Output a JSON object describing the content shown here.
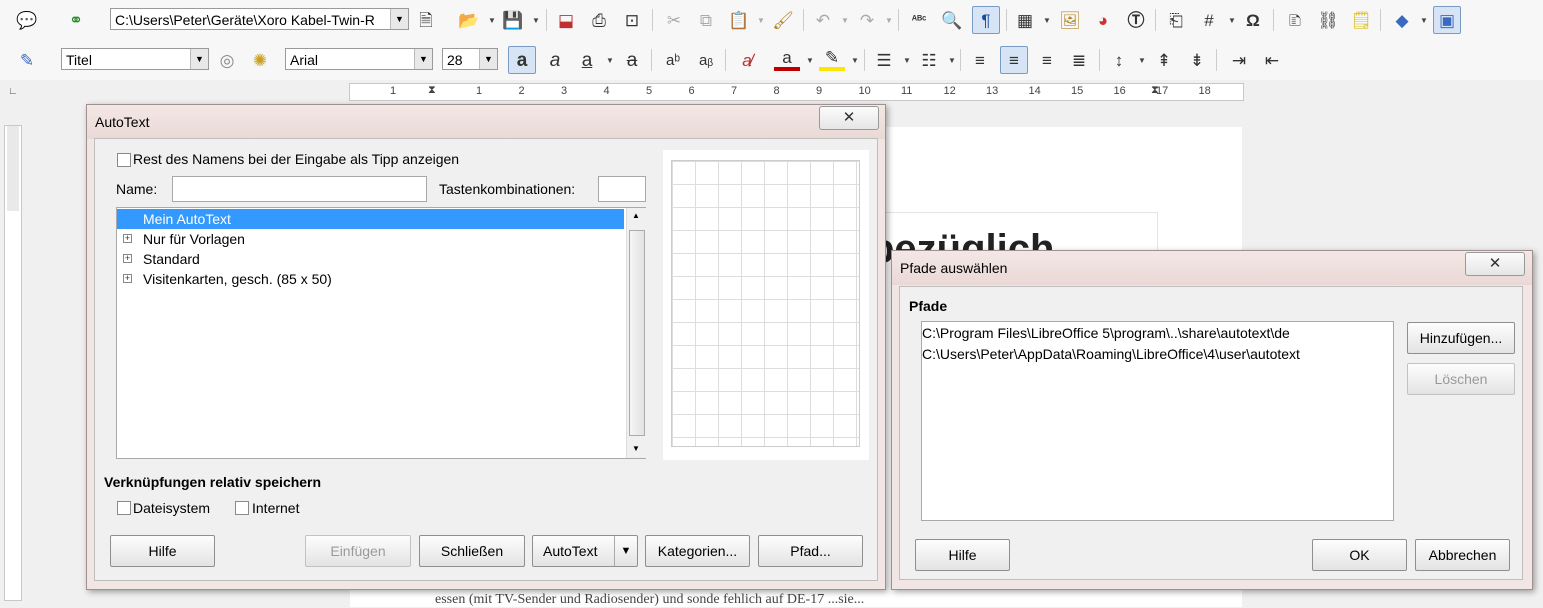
{
  "toolbar1": {
    "path_combo": "C:\\Users\\Peter\\Geräte\\Xoro Kabel-Twin-R"
  },
  "toolbar2": {
    "style_combo": "Titel",
    "font_combo": "Arial",
    "size_combo": "28"
  },
  "ruler": {
    "ticks": [
      "1",
      "1",
      "2",
      "3",
      "4",
      "5",
      "6",
      "7",
      "8",
      "9",
      "10",
      "11",
      "12",
      "13",
      "14",
      "15",
      "16",
      "17",
      "18"
    ]
  },
  "document": {
    "heading_fragment": "bezüglich",
    "body_fragment": "essen (mit TV-Sender und Radiosender) und sonde fehlich auf DE-17 ...sie..."
  },
  "autotext_dialog": {
    "title": "AutoText",
    "show_tip_label": "Rest des Namens bei der Eingabe als Tipp anzeigen",
    "name_label": "Name:",
    "name_value": "",
    "shortcut_label": "Tastenkombinationen:",
    "shortcut_value": "",
    "tree": [
      {
        "label": "Mein AutoText",
        "expandable": false,
        "selected": true
      },
      {
        "label": "Nur für Vorlagen",
        "expandable": true,
        "selected": false
      },
      {
        "label": "Standard",
        "expandable": true,
        "selected": false
      },
      {
        "label": "Visitenkarten, gesch. (85 x 50)",
        "expandable": true,
        "selected": false
      }
    ],
    "links_heading": "Verknüpfungen relativ speichern",
    "filesystem_label": "Dateisystem",
    "internet_label": "Internet",
    "buttons": {
      "help": "Hilfe",
      "insert": "Einfügen",
      "close": "Schließen",
      "autotext": "AutoText",
      "categories": "Kategorien...",
      "path": "Pfad..."
    }
  },
  "paths_dialog": {
    "title": "Pfade auswählen",
    "section": "Pfade",
    "paths": [
      "C:\\Program Files\\LibreOffice 5\\program\\..\\share\\autotext\\de",
      "C:\\Users\\Peter\\AppData\\Roaming\\LibreOffice\\4\\user\\autotext"
    ],
    "buttons": {
      "add": "Hinzufügen...",
      "delete": "Löschen",
      "help": "Hilfe",
      "ok": "OK",
      "cancel": "Abbrechen"
    }
  },
  "colors": {
    "selection": "#3399ff",
    "dialog_frame": "#f2e6e4"
  }
}
